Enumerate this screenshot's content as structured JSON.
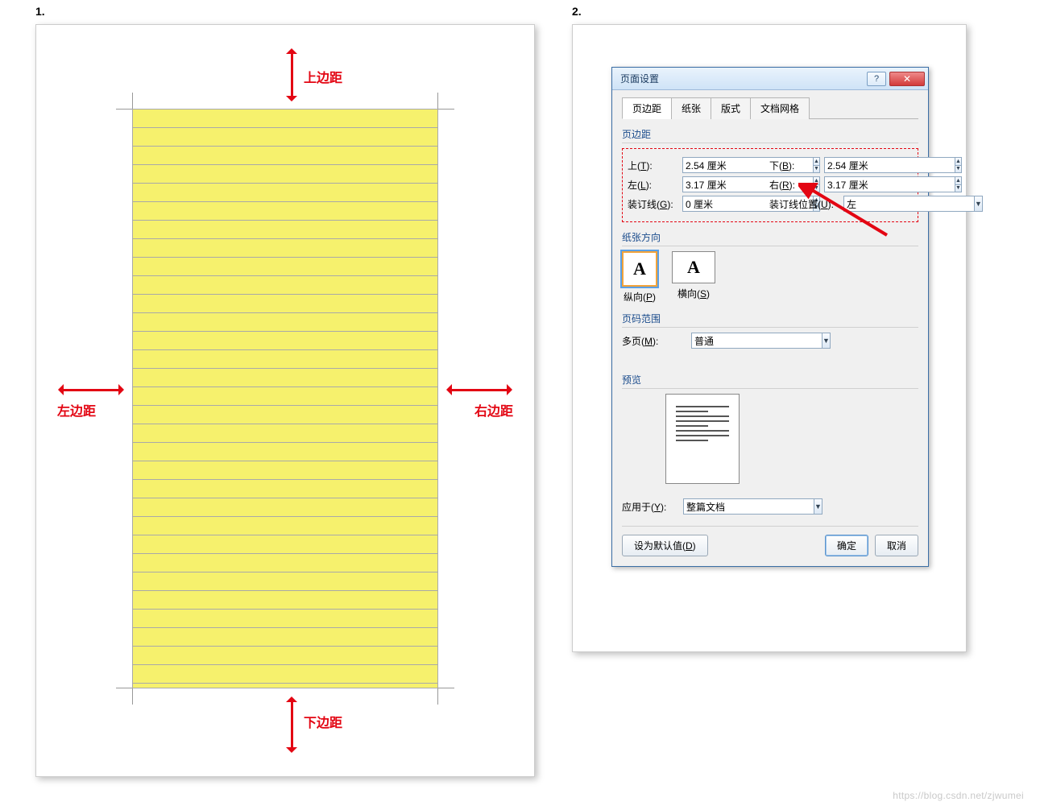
{
  "steps": {
    "one": "1.",
    "two": "2."
  },
  "page_diagram": {
    "labels": {
      "top": "上边距",
      "bottom": "下边距",
      "left": "左边距",
      "right": "右边距"
    }
  },
  "dialog": {
    "title": "页面设置",
    "tabs": {
      "margins": "页边距",
      "paper": "纸张",
      "layout": "版式",
      "grid": "文档网格"
    },
    "group_margins": "页边距",
    "fields": {
      "top_label": "上(T):",
      "top_value": "2.54 厘米",
      "bottom_label": "下(B):",
      "bottom_value": "2.54 厘米",
      "left_label": "左(L):",
      "left_value": "3.17 厘米",
      "right_label": "右(R):",
      "right_value": "3.17 厘米",
      "gutter_label": "装订线(G):",
      "gutter_value": "0 厘米",
      "gutter_pos_label": "装订线位置(U):",
      "gutter_pos_value": "左"
    },
    "group_orientation": "纸张方向",
    "orientation": {
      "portrait": "纵向(P)",
      "landscape": "横向(S)",
      "glyph": "A"
    },
    "group_pagerange": "页码范围",
    "multipage_label": "多页(M):",
    "multipage_value": "普通",
    "group_preview": "预览",
    "apply_label": "应用于(Y):",
    "apply_value": "整篇文档",
    "default_btn": "设为默认值(D)",
    "ok_btn": "确定",
    "cancel_btn": "取消",
    "help_glyph": "?",
    "close_glyph": "✕"
  },
  "watermark": "https://blog.csdn.net/zjwumei"
}
